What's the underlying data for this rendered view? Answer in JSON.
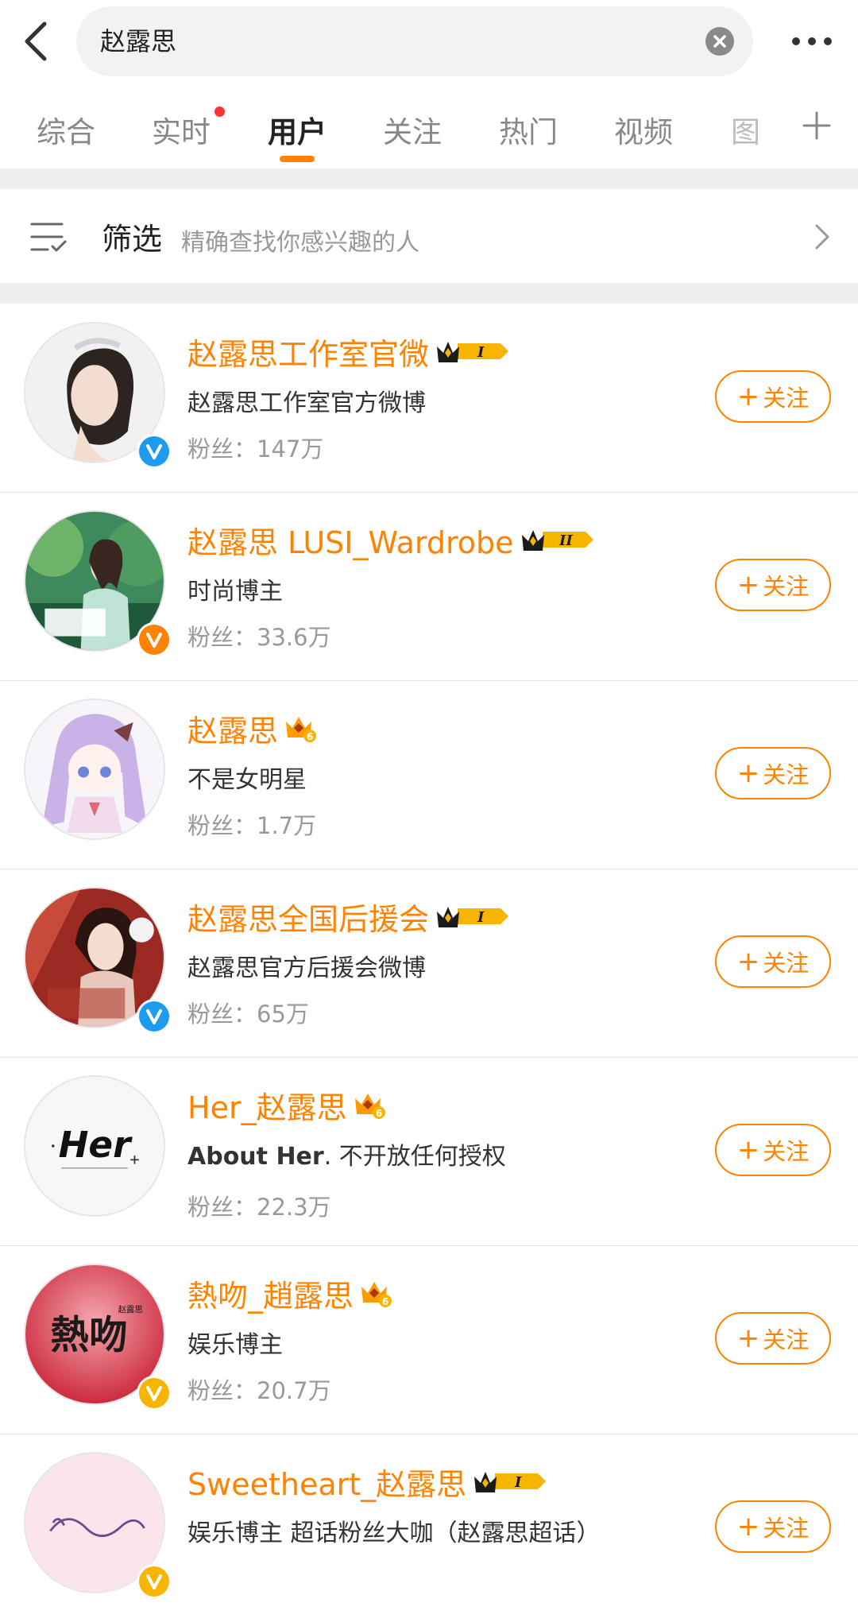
{
  "search": {
    "query": "赵露思"
  },
  "tabs": [
    "综合",
    "实时",
    "用户",
    "关注",
    "热门",
    "视频",
    "图"
  ],
  "filter": {
    "title": "筛选",
    "description": "精确查找你感兴趣的人"
  },
  "colors": {
    "accent": "#ff8200",
    "verified_blue": "#1d9bf0",
    "verified_orange": "#ff8200",
    "verified_gold": "#f7b500",
    "tab_badge": "#ff3333"
  },
  "follow_label": "关注",
  "users": [
    {
      "name": "赵露思工作室官微",
      "crown": "I",
      "desc": "赵露思工作室官方微博",
      "fans": "粉丝：147万",
      "verified": "blue",
      "avatar": "woman-portrait"
    },
    {
      "name": "赵露思 LUSI_Wardrobe",
      "crown": "II",
      "desc": "时尚博主",
      "fans": "粉丝：33.6万",
      "verified": "orange",
      "avatar": "green-photo"
    },
    {
      "name": "赵露思",
      "crown": "6",
      "desc": "不是女明星",
      "fans": "粉丝：1.7万",
      "verified": "",
      "avatar": "anime-girl"
    },
    {
      "name": "赵露思全国后援会",
      "crown": "I",
      "desc": "赵露思官方后援会微博",
      "fans": "粉丝：65万",
      "verified": "blue",
      "avatar": "red-photo"
    },
    {
      "name": "Her_赵露思",
      "crown": "6",
      "desc_bold": "About Her",
      "desc": ". 不开放任何授权",
      "fans": "粉丝：22.3万",
      "verified": "",
      "avatar": "her-logo"
    },
    {
      "name": "熱吻_趙露思",
      "crown": "6",
      "desc": "娱乐博主",
      "fans": "粉丝：20.7万",
      "verified": "gold",
      "avatar": "kiss-logo"
    },
    {
      "name": "Sweetheart_赵露思",
      "crown": "I",
      "desc": "娱乐博主 超话粉丝大咖（赵露思超话）",
      "fans": "",
      "verified": "gold",
      "avatar": "sweetheart-logo"
    }
  ]
}
